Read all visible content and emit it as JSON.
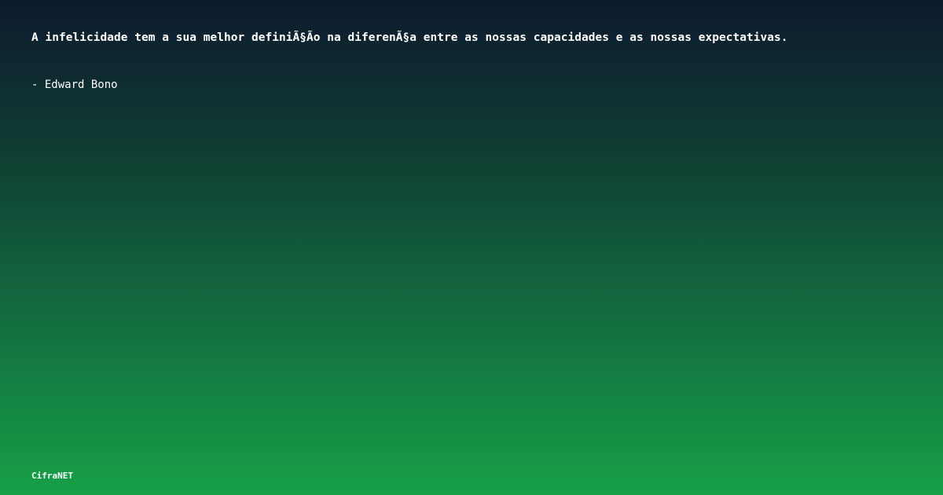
{
  "quote": {
    "text": "A infelicidade tem a sua melhor definiÃ§Ão na diferenÃ§a entre as nossas capacidades e as nossas expectativas.",
    "author": "- Edward Bono"
  },
  "brand": {
    "name": "CifraNET"
  },
  "colors": {
    "background_top": "#0d1a2e",
    "background_bottom": "#16a046",
    "text": "#ffffff"
  }
}
